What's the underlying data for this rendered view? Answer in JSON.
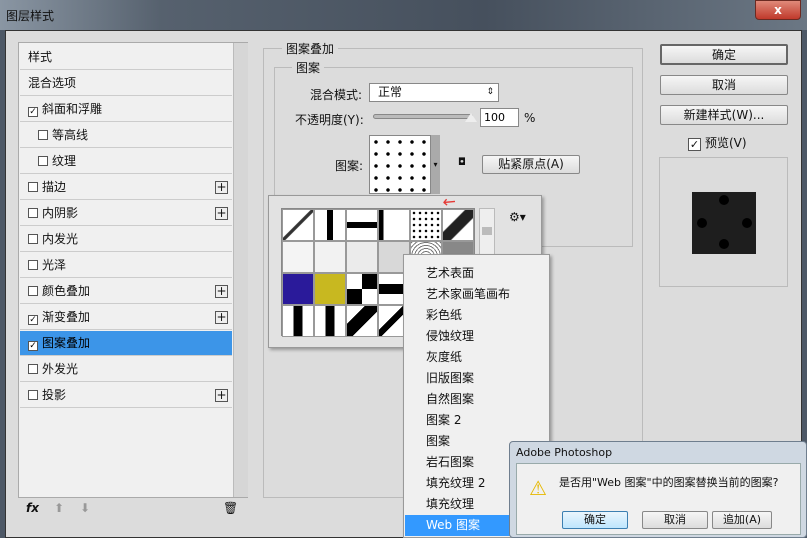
{
  "window": {
    "title": "图层样式",
    "close": "x"
  },
  "sidebar": {
    "items": [
      {
        "label": "样式",
        "checkbox": false,
        "checked": false,
        "plus": false,
        "sub": false
      },
      {
        "label": "混合选项",
        "checkbox": false,
        "checked": false,
        "plus": false,
        "sub": false
      },
      {
        "label": "斜面和浮雕",
        "checkbox": true,
        "checked": true,
        "plus": false,
        "sub": false
      },
      {
        "label": "等高线",
        "checkbox": true,
        "checked": false,
        "plus": false,
        "sub": true
      },
      {
        "label": "纹理",
        "checkbox": true,
        "checked": false,
        "plus": false,
        "sub": true
      },
      {
        "label": "描边",
        "checkbox": true,
        "checked": false,
        "plus": true,
        "sub": false
      },
      {
        "label": "内阴影",
        "checkbox": true,
        "checked": false,
        "plus": true,
        "sub": false
      },
      {
        "label": "内发光",
        "checkbox": true,
        "checked": false,
        "plus": false,
        "sub": false
      },
      {
        "label": "光泽",
        "checkbox": true,
        "checked": false,
        "plus": false,
        "sub": false
      },
      {
        "label": "颜色叠加",
        "checkbox": true,
        "checked": false,
        "plus": true,
        "sub": false
      },
      {
        "label": "渐变叠加",
        "checkbox": true,
        "checked": true,
        "plus": true,
        "sub": false
      },
      {
        "label": "图案叠加",
        "checkbox": true,
        "checked": true,
        "plus": false,
        "sub": false,
        "selected": true
      },
      {
        "label": "外发光",
        "checkbox": true,
        "checked": false,
        "plus": false,
        "sub": false
      },
      {
        "label": "投影",
        "checkbox": true,
        "checked": false,
        "plus": true,
        "sub": false
      }
    ],
    "fx": "fx"
  },
  "main": {
    "section": "图案叠加",
    "group": "图案",
    "blend_label": "混合模式:",
    "blend_value": "正常",
    "opacity_label": "不透明度(Y):",
    "opacity_value": "100",
    "opacity_unit": "%",
    "opacity_percent": 100,
    "pattern_label": "图案:",
    "snap_button": "贴紧原点(A)"
  },
  "right": {
    "ok": "确定",
    "cancel": "取消",
    "new_style": "新建样式(W)...",
    "preview_label": "预览(V)",
    "preview_checked": true
  },
  "menu": {
    "items": [
      "艺术表面",
      "艺术家画笔画布",
      "彩色纸",
      "侵蚀纹理",
      "灰度纸",
      "旧版图案",
      "自然图案",
      "图案 2",
      "图案",
      "岩石图案",
      "填充纹理 2",
      "填充纹理",
      "Web 图案"
    ],
    "selected": "Web 图案"
  },
  "alert": {
    "title": "Adobe Photoshop",
    "message": "是否用\"Web 图案\"中的图案替换当前的图案?",
    "ok": "确定",
    "cancel": "取消",
    "append": "追加(A)"
  },
  "colors": {
    "selection": "#3c95e8",
    "menu_selection": "#3399ff",
    "arrow": "#e53935"
  }
}
